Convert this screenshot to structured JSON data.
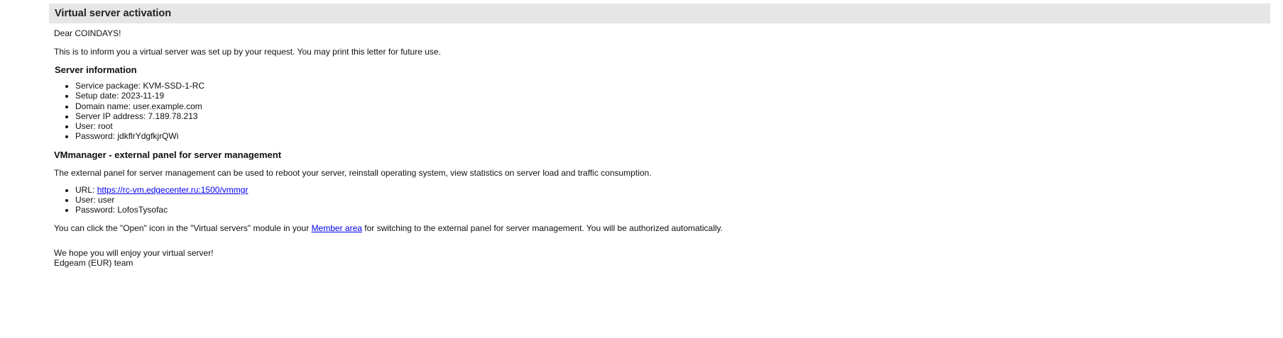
{
  "header": {
    "title": "Virtual server activation"
  },
  "letter": {
    "greeting": "Dear COINDAYS!",
    "intro": "This is to inform you a virtual server was set up by your request. You may print this letter for future use."
  },
  "server_info": {
    "heading": "Server information",
    "items": [
      {
        "label": "Service package:",
        "value": "KVM-SSD-1-RC"
      },
      {
        "label": "Setup date:",
        "value": "2023-11-19"
      },
      {
        "label": "Domain name:",
        "value": "user.example.com"
      },
      {
        "label": "Server IP address:",
        "value": "7.189.78.213"
      },
      {
        "label": "User:",
        "value": "root"
      },
      {
        "label": "Password:",
        "value": "jdkflrYdgfkjrQWi"
      }
    ]
  },
  "vmmanager": {
    "heading": "VMmanager - external panel for server management",
    "description": "The external panel for server management can be used to reboot your server, reinstall operating system, view statistics on server load and traffic consumption.",
    "url_label": "URL:",
    "url": "https://rc-vm.edgecenter.ru:1500/vmmgr",
    "user_label": "User:",
    "user": "user",
    "password_label": "Password:",
    "password": "LofosTysofac"
  },
  "open_note": {
    "before": "You can click the \"Open\" icon in the \"Virtual servers\" module in your ",
    "link": "Member area",
    "after": " for switching to the external panel for server management. You will be authorized automatically."
  },
  "closing": {
    "line1": "We hope you will enjoy your virtual server!",
    "line2": "Edgeam (EUR) team"
  },
  "colors": {
    "title_bar_bg": "#e6e6e6",
    "link": "#0000ee",
    "text": "#111111"
  }
}
